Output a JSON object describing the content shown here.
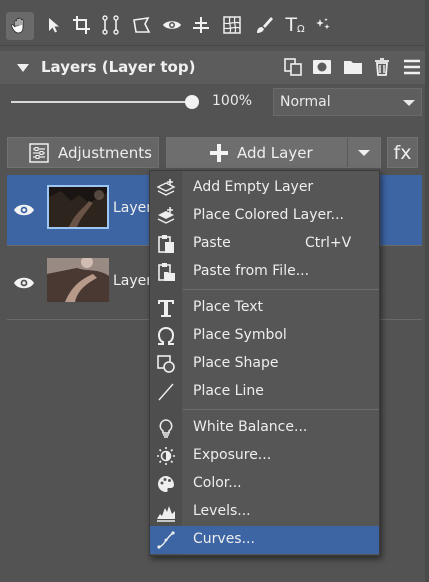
{
  "toolbar": {
    "tools": [
      "hand-icon",
      "arrow-icon",
      "crop-icon",
      "straighten-icon",
      "transform-icon",
      "eye-icon",
      "align-icon",
      "grid-warp-icon",
      "brush-icon",
      "text-icon",
      "effects-icon"
    ],
    "text_tool_label": "T",
    "text_tool_sub": "Ω"
  },
  "panel": {
    "title": "Layers (Layer top)",
    "header_icons": [
      "duplicate-layer-icon",
      "add-mask-icon",
      "folder-icon",
      "trash-icon",
      "hamburger-menu-icon"
    ]
  },
  "opacity": {
    "value_label": "100%",
    "value": 1.0
  },
  "blend_mode": {
    "selected": "Normal"
  },
  "buttons": {
    "adjustments": "Adjustments",
    "add_layer": "Add Layer",
    "fx": "fx"
  },
  "layers": [
    {
      "name": "Layer",
      "visible": true,
      "selected": true
    },
    {
      "name": "Layer",
      "visible": true,
      "selected": false
    }
  ],
  "menu": {
    "items": [
      {
        "label": "Add Empty Layer",
        "icon": "add-layer-icon"
      },
      {
        "label": "Place Colored Layer...",
        "icon": "colored-layer-icon"
      },
      {
        "label": "Paste",
        "shortcut": "Ctrl+V",
        "icon": "paste-icon"
      },
      {
        "label": "Paste from File...",
        "icon": "paste-file-icon"
      },
      {
        "label": "Place Text",
        "icon": "text-icon"
      },
      {
        "label": "Place Symbol",
        "icon": "omega-icon"
      },
      {
        "label": "Place Shape",
        "icon": "shape-icon"
      },
      {
        "label": "Place Line",
        "icon": "line-icon"
      },
      {
        "label": "White Balance...",
        "icon": "bulb-icon"
      },
      {
        "label": "Exposure...",
        "icon": "sun-icon"
      },
      {
        "label": "Color...",
        "icon": "palette-icon"
      },
      {
        "label": "Levels...",
        "icon": "histogram-icon"
      },
      {
        "label": "Curves...",
        "icon": "curve-icon",
        "highlighted": true
      }
    ]
  },
  "colors": {
    "accent": "#3d65a3",
    "background": "#535353"
  }
}
